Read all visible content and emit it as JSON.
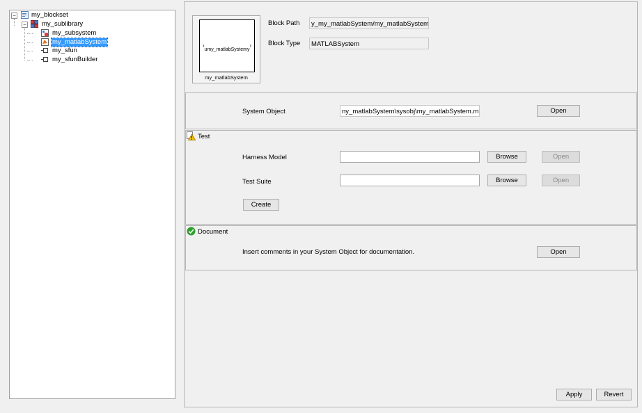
{
  "tree": {
    "root": "my_blockset",
    "library": "my_sublibrary",
    "items": [
      {
        "label": "my_subsystem",
        "icon": "subsystem-block-icon"
      },
      {
        "label": "my_matlabSystem",
        "icon": "matlab-system-block-icon",
        "selected": true
      },
      {
        "label": "my_sfun",
        "icon": "sfunction-block-icon"
      },
      {
        "label": "my_sfunBuilder",
        "icon": "sfunction-builder-block-icon"
      }
    ],
    "expander_collapse": "−"
  },
  "block": {
    "preview_port_in": "›",
    "preview_port_out": "›",
    "preview_text": "umy_matlabSystemy",
    "preview_caption": "my_matlabSystem",
    "path_label": "Block Path",
    "path_value": "y_my_matlabSystem/my_matlabSystem",
    "type_label": "Block Type",
    "type_value": "MATLABSystem"
  },
  "system_object": {
    "label": "System Object",
    "value": "ny_matlabSystem\\sysobj\\my_matlabSystem.m",
    "open_label": "Open"
  },
  "test": {
    "title": "Test",
    "status_icon": "warning-icon",
    "harness_label": "Harness Model",
    "harness_value": "",
    "suite_label": "Test Suite",
    "suite_value": "",
    "browse_label": "Browse",
    "open_label": "Open",
    "create_label": "Create"
  },
  "document": {
    "title": "Document",
    "status_icon": "checkmark-icon",
    "text": "Insert comments in your System Object for documentation.",
    "open_label": "Open"
  },
  "footer": {
    "apply_label": "Apply",
    "revert_label": "Revert"
  },
  "colors": {
    "selection": "#3399ff",
    "warning": "#f5c400",
    "ok": "#2e9e2e"
  }
}
